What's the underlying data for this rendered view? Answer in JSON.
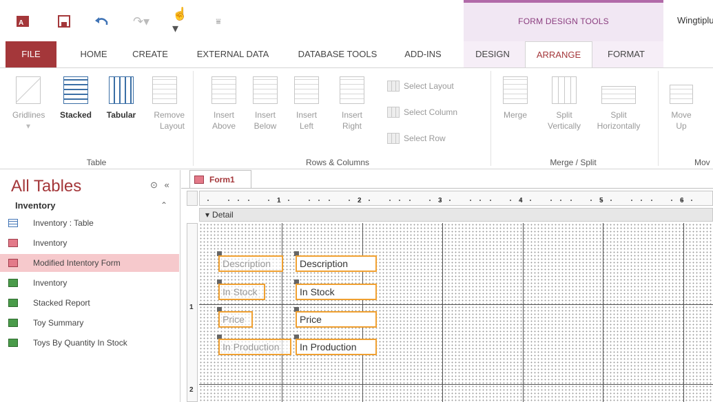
{
  "titlebar": {
    "context_group": "FORM DESIGN TOOLS",
    "window_title": "Wingtiplu"
  },
  "tabs": [
    {
      "label": "FILE"
    },
    {
      "label": "HOME"
    },
    {
      "label": "CREATE"
    },
    {
      "label": "EXTERNAL DATA"
    },
    {
      "label": "DATABASE TOOLS"
    },
    {
      "label": "ADD-INS"
    },
    {
      "label": "DESIGN"
    },
    {
      "label": "ARRANGE"
    },
    {
      "label": "FORMAT"
    }
  ],
  "active_tab": "ARRANGE",
  "ribbon": {
    "table": {
      "label": "Table",
      "gridlines": "Gridlines",
      "stacked": "Stacked",
      "tabular": "Tabular",
      "remove_layout_1": "Remove",
      "remove_layout_2": "Layout"
    },
    "rows_columns": {
      "label": "Rows & Columns",
      "insert": "Insert",
      "above": "Above",
      "below": "Below",
      "left": "Left",
      "right": "Right",
      "select_layout": "Select Layout",
      "select_column": "Select Column",
      "select_row": "Select Row"
    },
    "merge_split": {
      "label": "Merge / Split",
      "merge": "Merge",
      "split": "Split",
      "vertically": "Vertically",
      "horizontally": "Horizontally"
    },
    "move": {
      "label": "Mov",
      "move": "Move",
      "up": "Up"
    }
  },
  "nav": {
    "title": "All Tables",
    "group": "Inventory",
    "items": [
      {
        "label": "Inventory : Table",
        "icon": "table-icon"
      },
      {
        "label": "Inventory",
        "icon": "form-icon"
      },
      {
        "label": "Modified Intentory Form",
        "icon": "form-icon",
        "selected": true
      },
      {
        "label": "Inventory",
        "icon": "report-icon"
      },
      {
        "label": "Stacked Report",
        "icon": "report-icon"
      },
      {
        "label": "Toy Summary",
        "icon": "report-icon"
      },
      {
        "label": "Toys By Quantity In Stock",
        "icon": "report-icon"
      }
    ]
  },
  "document": {
    "tab": "Form1",
    "section": "Detail",
    "ruler_numbers": [
      "1",
      "2",
      "3",
      "4",
      "5",
      "6"
    ],
    "vruler_numbers": [
      "1",
      "2"
    ],
    "controls": [
      {
        "label": "Description",
        "field": "Description"
      },
      {
        "label": "In Stock",
        "field": "In Stock"
      },
      {
        "label": "Price",
        "field": "Price"
      },
      {
        "label": "In Production",
        "field": "In Production"
      }
    ]
  },
  "colors": {
    "accent": "#a4373a",
    "context": "#8a3c7e",
    "selection": "#f0a030"
  }
}
